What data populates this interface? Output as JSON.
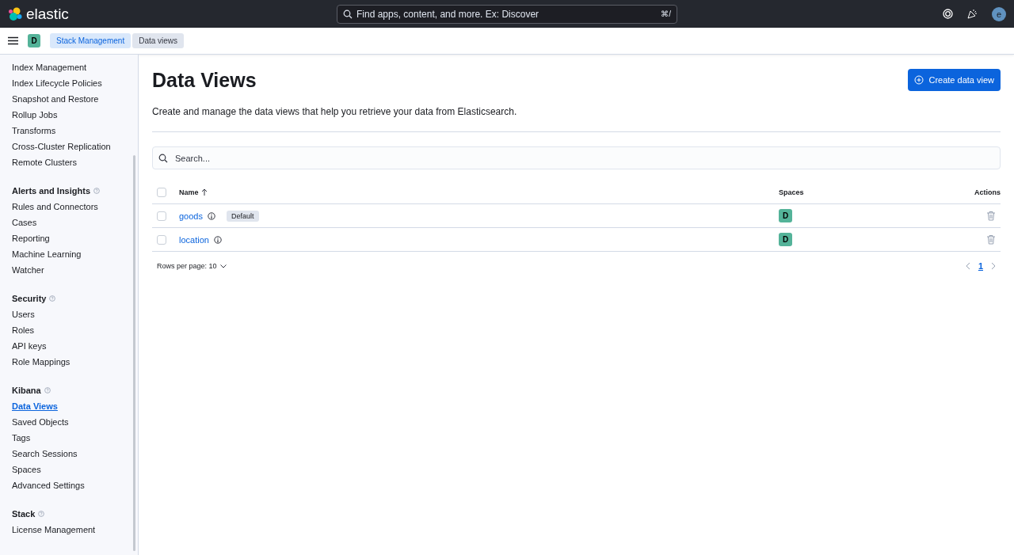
{
  "header": {
    "logo_text": "elastic",
    "search": {
      "placeholder": "Find apps, content, and more. Ex: Discover",
      "shortcut": "⌘/"
    },
    "avatar": "e"
  },
  "breadcrumb_bar": {
    "space": "D",
    "crumbs": [
      {
        "label": "Stack Management",
        "selected": false
      },
      {
        "label": "Data views",
        "selected": true
      }
    ]
  },
  "sidebar": {
    "sections": [
      {
        "items": [
          {
            "label": "Index Management",
            "selected": false
          },
          {
            "label": "Index Lifecycle Policies",
            "selected": false
          },
          {
            "label": "Snapshot and Restore",
            "selected": false
          },
          {
            "label": "Rollup Jobs",
            "selected": false
          },
          {
            "label": "Transforms",
            "selected": false
          },
          {
            "label": "Cross-Cluster Replication",
            "selected": false
          },
          {
            "label": "Remote Clusters",
            "selected": false
          }
        ]
      },
      {
        "title": "Alerts and Insights",
        "items": [
          {
            "label": "Rules and Connectors",
            "selected": false
          },
          {
            "label": "Cases",
            "selected": false
          },
          {
            "label": "Reporting",
            "selected": false
          },
          {
            "label": "Machine Learning",
            "selected": false
          },
          {
            "label": "Watcher",
            "selected": false
          }
        ]
      },
      {
        "title": "Security",
        "items": [
          {
            "label": "Users",
            "selected": false
          },
          {
            "label": "Roles",
            "selected": false
          },
          {
            "label": "API keys",
            "selected": false
          },
          {
            "label": "Role Mappings",
            "selected": false
          }
        ]
      },
      {
        "title": "Kibana",
        "items": [
          {
            "label": "Data Views",
            "selected": true
          },
          {
            "label": "Saved Objects",
            "selected": false
          },
          {
            "label": "Tags",
            "selected": false
          },
          {
            "label": "Search Sessions",
            "selected": false
          },
          {
            "label": "Spaces",
            "selected": false
          },
          {
            "label": "Advanced Settings",
            "selected": false
          }
        ]
      },
      {
        "title": "Stack",
        "items": [
          {
            "label": "License Management",
            "selected": false
          }
        ]
      }
    ]
  },
  "page": {
    "title": "Data Views",
    "create_button": "Create data view",
    "description": "Create and manage the data views that help you retrieve your data from Elasticsearch.",
    "search": {
      "placeholder": "Search..."
    },
    "table": {
      "select_all_checked": false,
      "columns": [
        "Name",
        "Spaces",
        "Actions"
      ],
      "rows": [
        {
          "checked": false,
          "name": "goods",
          "badge": "Default",
          "space": "D"
        },
        {
          "checked": false,
          "name": "location",
          "space": "D"
        }
      ]
    },
    "rows_per_page": "Rows per page: 10",
    "pages": [
      {
        "label": "1",
        "selected": true
      }
    ]
  }
}
